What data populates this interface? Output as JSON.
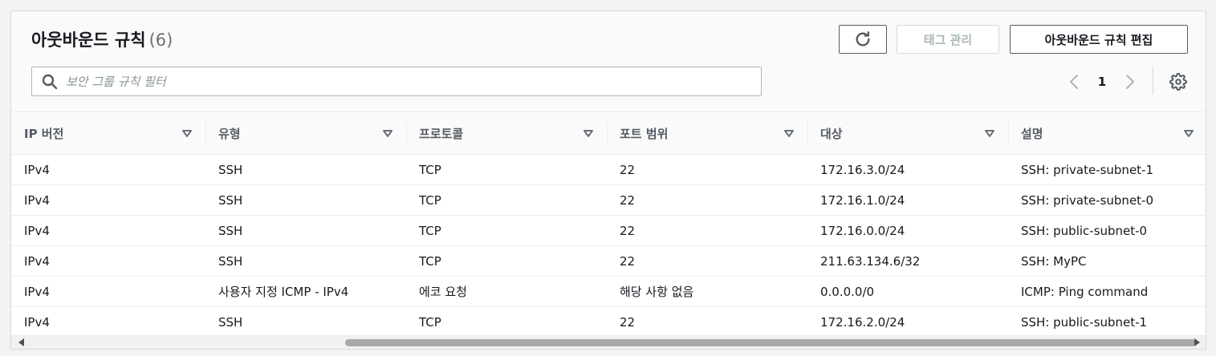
{
  "header": {
    "title": "아웃바운드 규칙",
    "count": "(6)",
    "tags_label": "태그 관리",
    "edit_label": "아웃바운드 규칙 편집"
  },
  "search": {
    "placeholder": "보안 그룹 규칙 필터",
    "value": ""
  },
  "pagination": {
    "current_page": "1"
  },
  "icons": {
    "refresh": "refresh-icon",
    "search": "search-icon",
    "prev": "chevron-left-icon",
    "next": "chevron-right-icon",
    "settings": "gear-icon",
    "sort": "sort-down-icon"
  },
  "colors": {
    "text": "#16191f",
    "muted": "#687078",
    "border": "#545b64",
    "disabled": "#aab7b8"
  },
  "table": {
    "columns": [
      "IP 버전",
      "유형",
      "프로토콜",
      "포트 범위",
      "대상",
      "설명"
    ],
    "rows": [
      [
        "IPv4",
        "SSH",
        "TCP",
        "22",
        "172.16.3.0/24",
        "SSH: private-subnet-1"
      ],
      [
        "IPv4",
        "SSH",
        "TCP",
        "22",
        "172.16.1.0/24",
        "SSH: private-subnet-0"
      ],
      [
        "IPv4",
        "SSH",
        "TCP",
        "22",
        "172.16.0.0/24",
        "SSH: public-subnet-0"
      ],
      [
        "IPv4",
        "SSH",
        "TCP",
        "22",
        "211.63.134.6/32",
        "SSH: MyPC"
      ],
      [
        "IPv4",
        "사용자 지정 ICMP - IPv4",
        "에코 요청",
        "해당 사항 없음",
        "0.0.0.0/0",
        "ICMP: Ping command"
      ],
      [
        "IPv4",
        "SSH",
        "TCP",
        "22",
        "172.16.2.0/24",
        "SSH: public-subnet-1"
      ]
    ]
  }
}
